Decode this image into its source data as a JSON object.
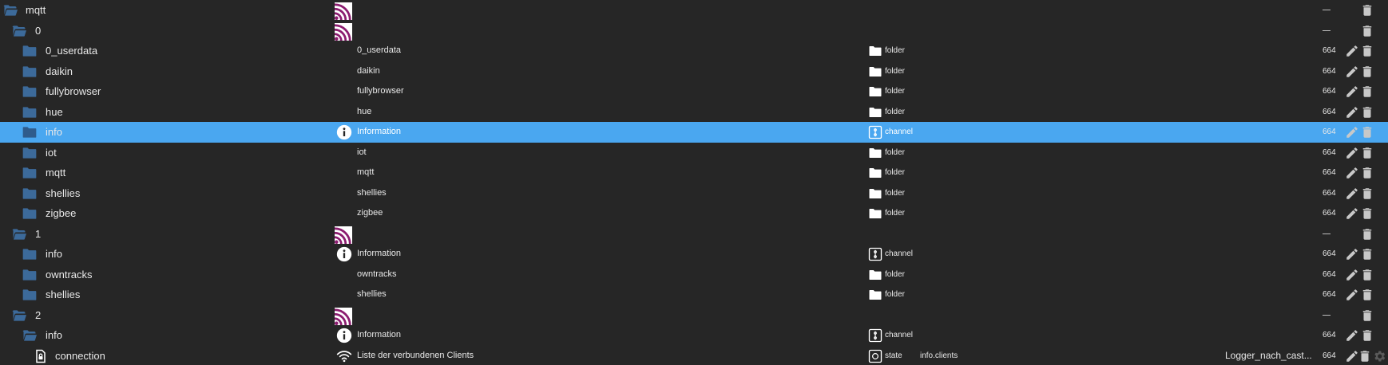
{
  "colors": {
    "background": "#262626",
    "selected_row": "#4aa7f0",
    "folder_icon": "#3c6a9a",
    "adapter_icon": "#8b1c6f",
    "action_icon": "#c8c8c8"
  },
  "icon_names": {
    "folder_open": "folder-open-icon",
    "folder_closed": "folder-icon",
    "state": "state-document-icon",
    "adapter": "mqtt-adapter-icon",
    "info": "info-icon",
    "wifi": "wifi-icon",
    "edit": "pencil-icon",
    "delete": "trash-icon",
    "settings": "gear-icon"
  },
  "rows": [
    {
      "id": "mqtt",
      "name": "",
      "type": "",
      "role": "",
      "room": "",
      "acl": "",
      "dash": true,
      "level": 0,
      "icon": "folder-open",
      "name_icon": "adapter",
      "type_icon": "",
      "selected": false,
      "edit": false,
      "settings": false
    },
    {
      "id": "0",
      "name": "",
      "type": "",
      "role": "",
      "room": "",
      "acl": "",
      "dash": true,
      "level": 1,
      "icon": "folder-open",
      "name_icon": "adapter",
      "type_icon": "",
      "selected": false,
      "edit": false,
      "settings": false
    },
    {
      "id": "0_userdata",
      "name": "0_userdata",
      "type": "folder",
      "role": "",
      "room": "",
      "acl": "664",
      "dash": false,
      "level": 2,
      "icon": "folder",
      "name_icon": "",
      "type_icon": "folder",
      "selected": false,
      "edit": true,
      "settings": false
    },
    {
      "id": "daikin",
      "name": "daikin",
      "type": "folder",
      "role": "",
      "room": "",
      "acl": "664",
      "dash": false,
      "level": 2,
      "icon": "folder",
      "name_icon": "",
      "type_icon": "folder",
      "selected": false,
      "edit": true,
      "settings": false
    },
    {
      "id": "fullybrowser",
      "name": "fullybrowser",
      "type": "folder",
      "role": "",
      "room": "",
      "acl": "664",
      "dash": false,
      "level": 2,
      "icon": "folder",
      "name_icon": "",
      "type_icon": "folder",
      "selected": false,
      "edit": true,
      "settings": false
    },
    {
      "id": "hue",
      "name": "hue",
      "type": "folder",
      "role": "",
      "room": "",
      "acl": "664",
      "dash": false,
      "level": 2,
      "icon": "folder",
      "name_icon": "",
      "type_icon": "folder",
      "selected": false,
      "edit": true,
      "settings": false
    },
    {
      "id": "info",
      "name": "Information",
      "type": "channel",
      "role": "",
      "room": "",
      "acl": "664",
      "dash": false,
      "level": 2,
      "icon": "folder",
      "name_icon": "info",
      "type_icon": "channel",
      "selected": true,
      "edit": true,
      "settings": false
    },
    {
      "id": "iot",
      "name": "iot",
      "type": "folder",
      "role": "",
      "room": "",
      "acl": "664",
      "dash": false,
      "level": 2,
      "icon": "folder",
      "name_icon": "",
      "type_icon": "folder",
      "selected": false,
      "edit": true,
      "settings": false
    },
    {
      "id": "mqtt",
      "name": "mqtt",
      "type": "folder",
      "role": "",
      "room": "",
      "acl": "664",
      "dash": false,
      "level": 2,
      "icon": "folder",
      "name_icon": "",
      "type_icon": "folder",
      "selected": false,
      "edit": true,
      "settings": false
    },
    {
      "id": "shellies",
      "name": "shellies",
      "type": "folder",
      "role": "",
      "room": "",
      "acl": "664",
      "dash": false,
      "level": 2,
      "icon": "folder",
      "name_icon": "",
      "type_icon": "folder",
      "selected": false,
      "edit": true,
      "settings": false
    },
    {
      "id": "zigbee",
      "name": "zigbee",
      "type": "folder",
      "role": "",
      "room": "",
      "acl": "664",
      "dash": false,
      "level": 2,
      "icon": "folder",
      "name_icon": "",
      "type_icon": "folder",
      "selected": false,
      "edit": true,
      "settings": false
    },
    {
      "id": "1",
      "name": "",
      "type": "",
      "role": "",
      "room": "",
      "acl": "",
      "dash": true,
      "level": 1,
      "icon": "folder-open",
      "name_icon": "adapter",
      "type_icon": "",
      "selected": false,
      "edit": false,
      "settings": false
    },
    {
      "id": "info",
      "name": "Information",
      "type": "channel",
      "role": "",
      "room": "",
      "acl": "664",
      "dash": false,
      "level": 2,
      "icon": "folder",
      "name_icon": "info",
      "type_icon": "channel",
      "selected": false,
      "edit": true,
      "settings": false
    },
    {
      "id": "owntracks",
      "name": "owntracks",
      "type": "folder",
      "role": "",
      "room": "",
      "acl": "664",
      "dash": false,
      "level": 2,
      "icon": "folder",
      "name_icon": "",
      "type_icon": "folder",
      "selected": false,
      "edit": true,
      "settings": false
    },
    {
      "id": "shellies",
      "name": "shellies",
      "type": "folder",
      "role": "",
      "room": "",
      "acl": "664",
      "dash": false,
      "level": 2,
      "icon": "folder",
      "name_icon": "",
      "type_icon": "folder",
      "selected": false,
      "edit": true,
      "settings": false
    },
    {
      "id": "2",
      "name": "",
      "type": "",
      "role": "",
      "room": "",
      "acl": "",
      "dash": true,
      "level": 1,
      "icon": "folder-open",
      "name_icon": "adapter",
      "type_icon": "",
      "selected": false,
      "edit": false,
      "settings": false
    },
    {
      "id": "info",
      "name": "Information",
      "type": "channel",
      "role": "",
      "room": "",
      "acl": "664",
      "dash": false,
      "level": 2,
      "icon": "folder-open",
      "name_icon": "info",
      "type_icon": "channel",
      "selected": false,
      "edit": true,
      "settings": false
    },
    {
      "id": "connection",
      "name": "Liste der verbundenen Clients",
      "type": "state",
      "role": "info.clients",
      "room": "Logger_nach_cast...",
      "acl": "664",
      "dash": false,
      "level": 3,
      "icon": "state",
      "name_icon": "wifi",
      "type_icon": "state",
      "selected": false,
      "edit": true,
      "settings": true
    }
  ]
}
